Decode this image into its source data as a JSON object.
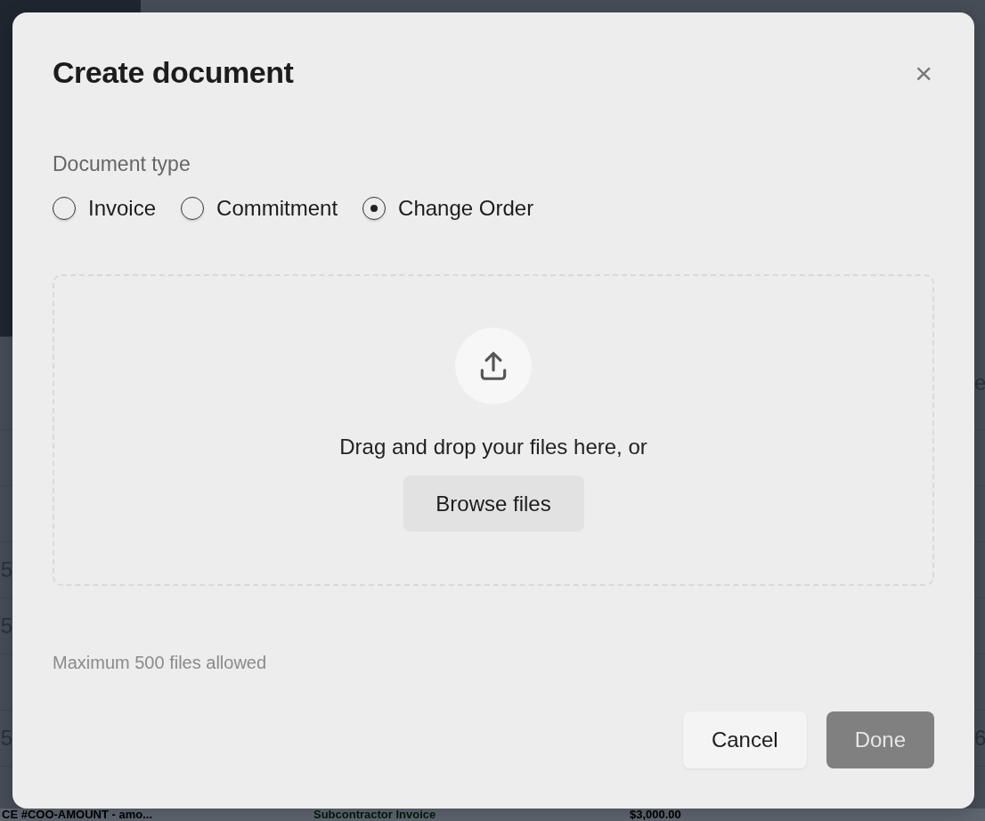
{
  "background": {
    "right_fragments": [
      {
        "text": "e"
      },
      {
        "text": "6"
      }
    ],
    "left_fragments": [
      "5",
      "5",
      "5"
    ],
    "bottom_row": {
      "name": "CE #COO-AMOUNT - amo...",
      "type": "Subcontractor Invoice",
      "amount": "$3,000.00"
    }
  },
  "dialog": {
    "title": "Create document",
    "close_label": "×",
    "document_type": {
      "label": "Document type",
      "options": [
        {
          "label": "Invoice",
          "selected": false
        },
        {
          "label": "Commitment",
          "selected": false
        },
        {
          "label": "Change Order",
          "selected": true
        }
      ]
    },
    "dropzone": {
      "prompt": "Drag and drop your files here, or",
      "browse_button": "Browse files"
    },
    "note": "Maximum 500 files allowed",
    "buttons": [
      {
        "label": "Cancel",
        "kind": "secondary",
        "disabled": false
      },
      {
        "label": "Done",
        "kind": "primary",
        "disabled": true
      }
    ]
  }
}
